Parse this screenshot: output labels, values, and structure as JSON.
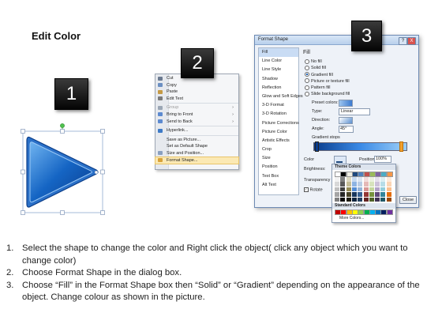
{
  "title": "Edit Color",
  "badges": {
    "one": "1",
    "two": "2",
    "three": "3"
  },
  "context_menu": {
    "items": [
      {
        "label": "Cut",
        "icon": "scissors-icon",
        "color": "#6b7a90",
        "enabled": true,
        "submenu": false
      },
      {
        "label": "Copy",
        "icon": "copy-icon",
        "color": "#6b8fc2",
        "enabled": true,
        "submenu": false
      },
      {
        "label": "Paste",
        "icon": "paste-icon",
        "color": "#c59a45",
        "enabled": true,
        "submenu": false
      },
      {
        "label": "Edit Text",
        "icon": "text-icon",
        "color": "#7a7a7a",
        "enabled": true,
        "submenu": false
      },
      {
        "label": "Group",
        "icon": "group-icon",
        "color": "#9aa6b5",
        "enabled": false,
        "submenu": true
      },
      {
        "label": "Bring to Front",
        "icon": "bring-front-icon",
        "color": "#5c8ad0",
        "enabled": true,
        "submenu": true
      },
      {
        "label": "Send to Back",
        "icon": "send-back-icon",
        "color": "#5c8ad0",
        "enabled": true,
        "submenu": true
      },
      {
        "label": "Hyperlink...",
        "icon": "hyperlink-icon",
        "color": "#3d7ac7",
        "enabled": true,
        "submenu": false
      },
      {
        "label": "Save as Picture...",
        "icon": "",
        "color": "",
        "enabled": true,
        "submenu": false
      },
      {
        "label": "Set as Default Shape",
        "icon": "",
        "color": "",
        "enabled": true,
        "submenu": false
      },
      {
        "label": "Size and Position...",
        "icon": "size-icon",
        "color": "#8aa0c0",
        "enabled": true,
        "submenu": false
      },
      {
        "label": "Format Shape...",
        "icon": "format-shape-icon",
        "color": "#d8a23a",
        "enabled": true,
        "submenu": false,
        "highlighted": true
      }
    ]
  },
  "dialog": {
    "title": "Format Shape",
    "help": "?",
    "close": "X",
    "categories": [
      "Fill",
      "Line Color",
      "Line Style",
      "Shadow",
      "Reflection",
      "Glow and Soft Edges",
      "3-D Format",
      "3-D Rotation",
      "Picture Corrections",
      "Picture Color",
      "Artistic Effects",
      "Crop",
      "Size",
      "Position",
      "Text Box",
      "Alt Text"
    ],
    "selected_category": "Fill",
    "fill_heading": "Fill",
    "options": [
      "No fill",
      "Solid fill",
      "Gradient fill",
      "Picture or texture fill",
      "Pattern fill",
      "Slide background fill"
    ],
    "selected_option": "Gradient fill",
    "preset_label": "Preset colors:",
    "type_label": "Type:",
    "type_value": "Linear",
    "direction_label": "Direction:",
    "angle_label": "Angle:",
    "angle_value": "45°",
    "stops_label": "Gradient stops",
    "color_label": "Color",
    "position_label": "Position:",
    "position_value": "100%",
    "brightness_label": "Brightness:",
    "transparency_label": "Transparency",
    "rotate_label": "Rotate",
    "close_button": "Close"
  },
  "palette": {
    "theme_label": "Theme Colors",
    "standard_label": "Standard Colors",
    "more_label": "More Colors...",
    "theme_top": [
      "#ffffff",
      "#000000",
      "#eeece1",
      "#1f497d",
      "#4f81bd",
      "#c0504d",
      "#9bbb59",
      "#8064a2",
      "#4bacc6",
      "#f79646"
    ],
    "theme_cols": [
      [
        "#f2f2f2",
        "#d8d8d8",
        "#bfbfbf",
        "#a5a5a5",
        "#7f7f7f"
      ],
      [
        "#7f7f7f",
        "#595959",
        "#3f3f3f",
        "#262626",
        "#0c0c0c"
      ],
      [
        "#ddd9c3",
        "#c4bd97",
        "#938953",
        "#494429",
        "#1d1b10"
      ],
      [
        "#c6d9f0",
        "#8db3e2",
        "#548dd4",
        "#17365d",
        "#0f243e"
      ],
      [
        "#dbe5f1",
        "#b8cce4",
        "#95b3d7",
        "#366092",
        "#244061"
      ],
      [
        "#f2dcdb",
        "#e5b9b7",
        "#d99694",
        "#953734",
        "#632423"
      ],
      [
        "#ebf1dd",
        "#d7e3bc",
        "#c3d69b",
        "#76923c",
        "#4f6128"
      ],
      [
        "#e5e0ec",
        "#ccc1d9",
        "#b2a2c7",
        "#5f497a",
        "#3f3151"
      ],
      [
        "#dbeef3",
        "#b7dde8",
        "#92cddc",
        "#31859b",
        "#205867"
      ],
      [
        "#fdeada",
        "#fbd5b5",
        "#fac08f",
        "#e36c09",
        "#974806"
      ]
    ],
    "standard": [
      "#c00000",
      "#ff0000",
      "#ffc000",
      "#ffff00",
      "#92d050",
      "#00b050",
      "#00b0f0",
      "#0070c0",
      "#002060",
      "#7030a0"
    ]
  },
  "instructions": [
    {
      "num": "1.",
      "text": "Select the shape to change the color and Right click the object( click any object which you want to change color)"
    },
    {
      "num": "2.",
      "text": "Choose Format Shape in the dialog box."
    },
    {
      "num": "3.",
      "text": "Choose “Fill” in the Format Shape box then “Solid” or “Gradient” depending on the appearance of the object. Change colour as shown in the picture."
    }
  ],
  "colors": {
    "shape_dark": "#0d4aa3",
    "shape_light": "#4a9be8",
    "selection": "#2e8b2e"
  }
}
